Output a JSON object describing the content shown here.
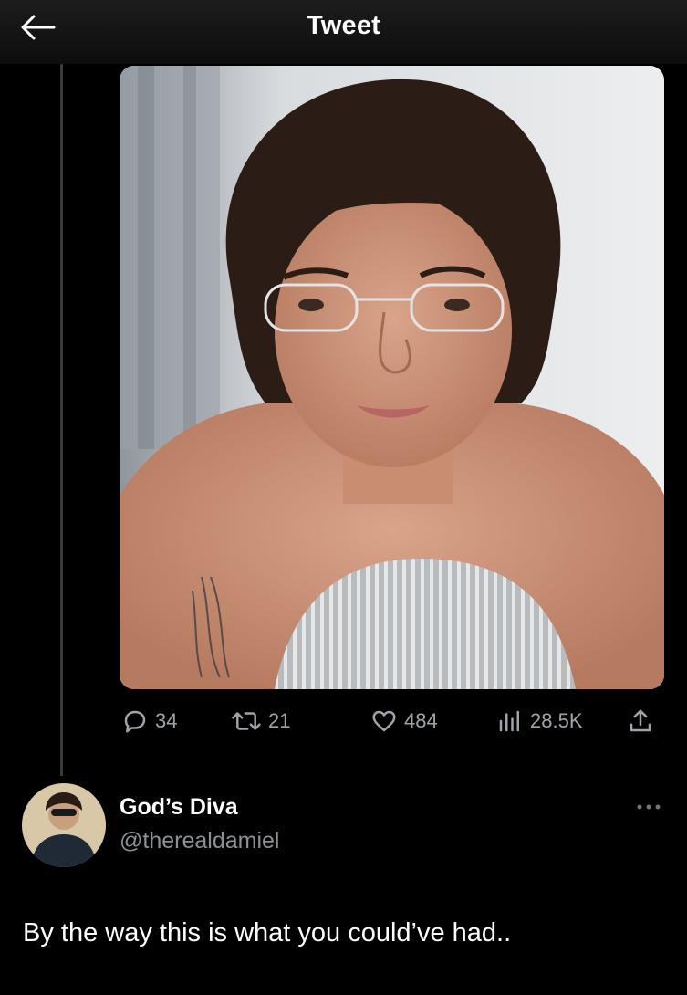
{
  "header": {
    "title": "Tweet",
    "back_icon": "arrow-left-icon"
  },
  "media": {
    "icon": "photo-image"
  },
  "actions": {
    "replies": "34",
    "retweets": "21",
    "likes": "484",
    "views": "28.5K",
    "icons": [
      "reply-icon",
      "retweet-icon",
      "heart-icon",
      "views-icon",
      "share-icon"
    ]
  },
  "author": {
    "display_name": "God’s Diva",
    "handle": "@therealdamiel"
  },
  "tweet": {
    "text": "By the way this is what you could’ve had.."
  },
  "colors": {
    "background": "#000000",
    "text": "#ffffff",
    "muted": "#8b9096",
    "thread_line": "#3a3a3a"
  }
}
